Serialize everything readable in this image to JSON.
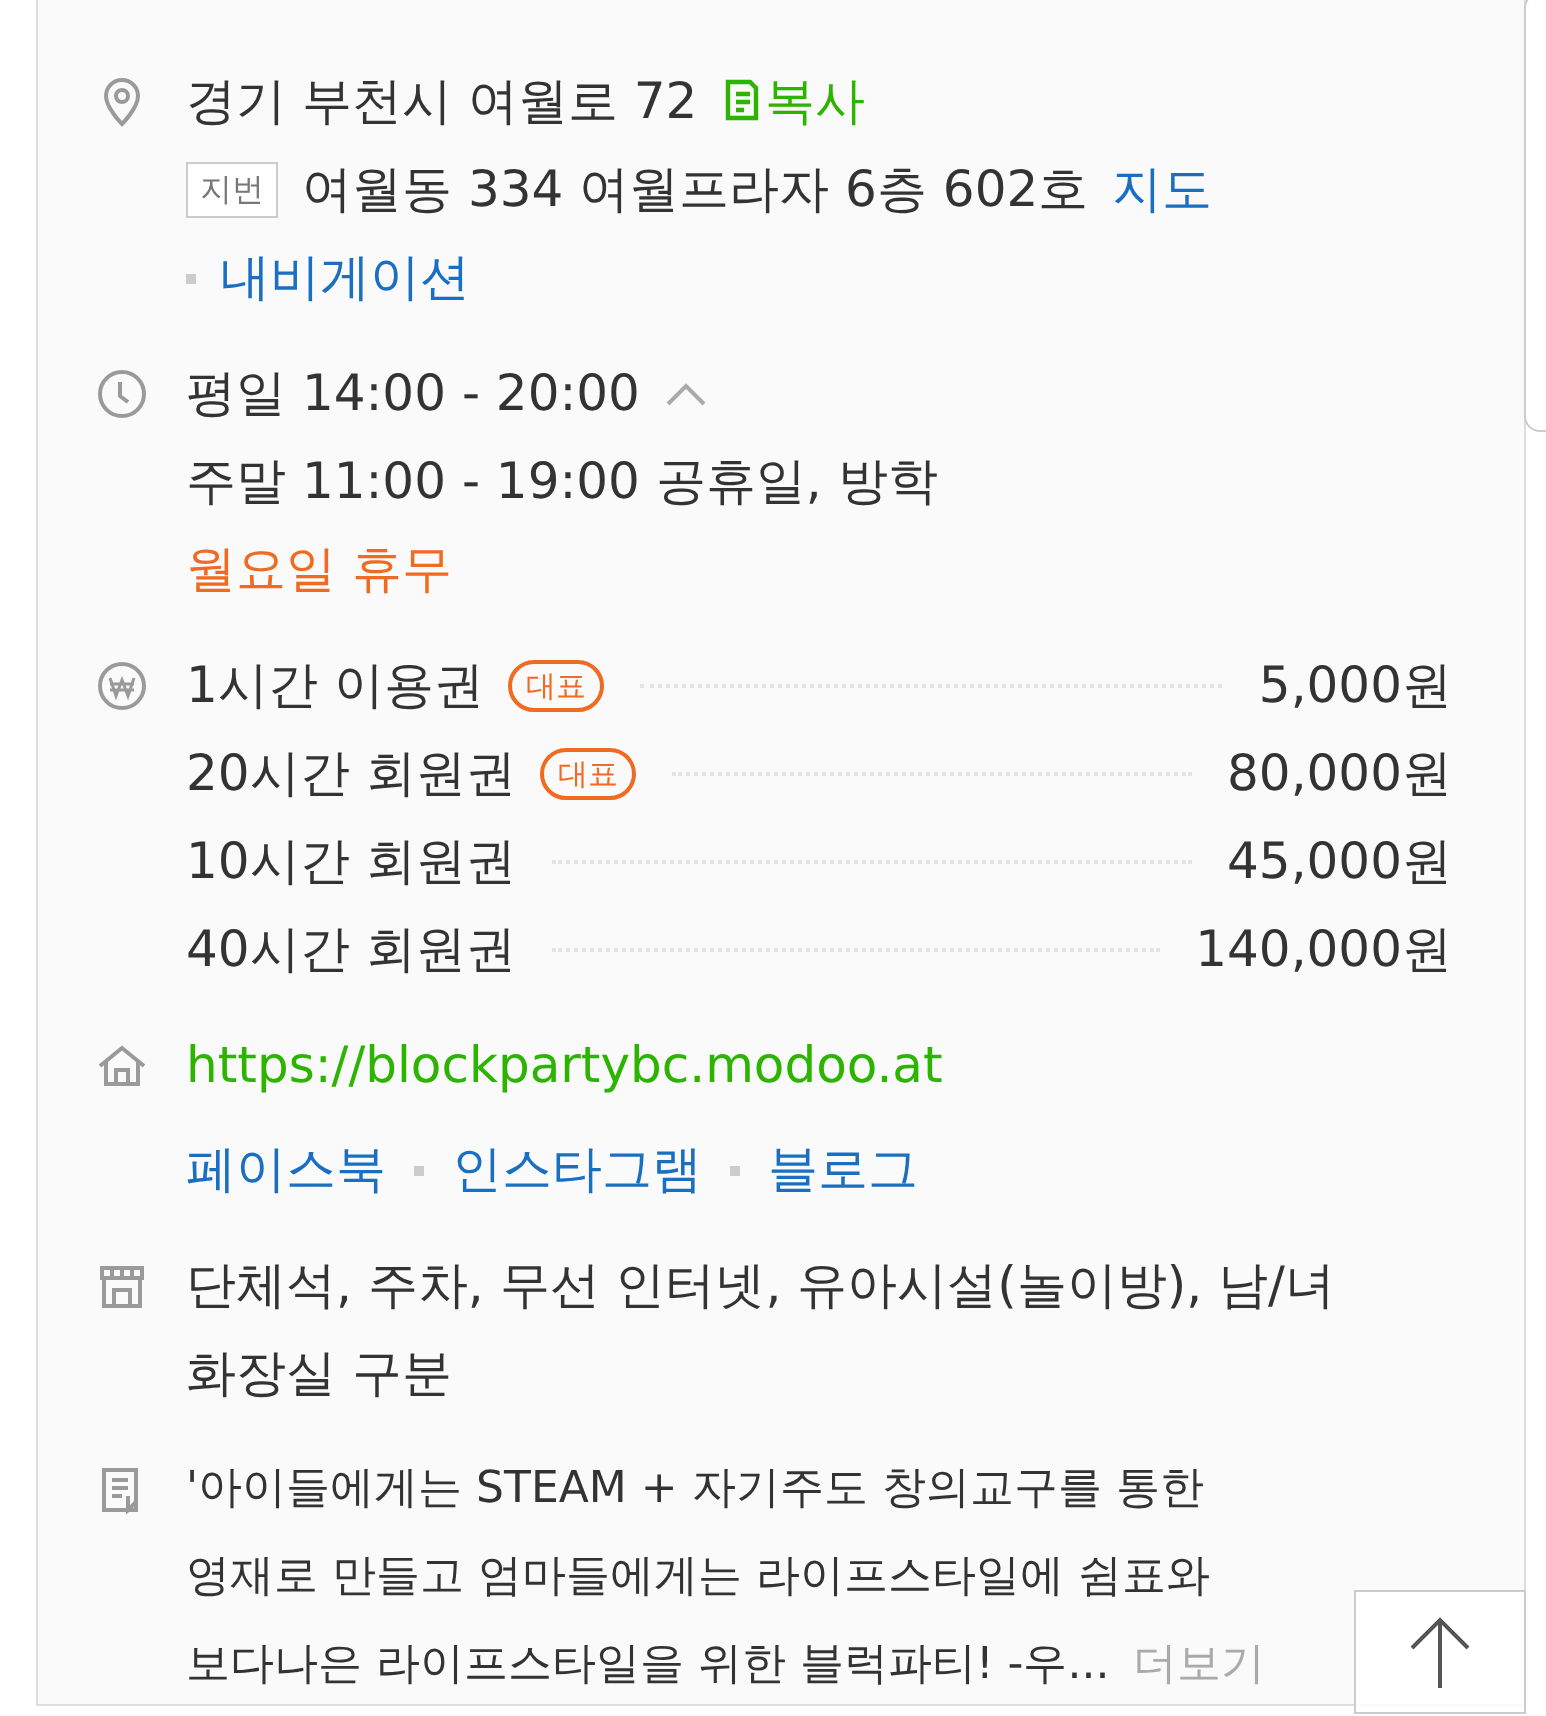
{
  "address": {
    "road": "경기 부천시 여월로 72",
    "copy": "복사",
    "lot_tag": "지번",
    "lot": "여월동 334 여월프라자 6층 602호",
    "map": "지도",
    "navigation": "내비게이션"
  },
  "hours": {
    "weekday": "평일 14:00 - 20:00",
    "expanded": true,
    "lines": [
      {
        "text": "주말 11:00 - 19:00 공휴일, 방학",
        "kind": "normal"
      },
      {
        "text": "월요일 휴무",
        "kind": "closed"
      }
    ]
  },
  "prices": [
    {
      "name": "1시간 이용권",
      "badge": "대표",
      "price": "5,000원"
    },
    {
      "name": "20시간 회원권",
      "badge": "대표",
      "price": "80,000원"
    },
    {
      "name": "10시간 회원권",
      "price": "45,000원"
    },
    {
      "name": "40시간 회원권",
      "price": "140,000원"
    }
  ],
  "homepage": {
    "url": "https://blockpartybc.modoo.at",
    "links": [
      "페이스북",
      "인스타그램",
      "블로그"
    ]
  },
  "facilities": "단체석, 주차, 무선 인터넷, 유아시설(놀이방), 남/녀 화장실 구분",
  "description": {
    "text": "'아이들에게는 STEAM + 자기주도 창의교구를 통한 영재로 만들고 엄마들에게는 라이프스타일에 쉼표와 보다나은 라이프스타일을 위한 블럭파티! -우...",
    "more": "더보기"
  }
}
